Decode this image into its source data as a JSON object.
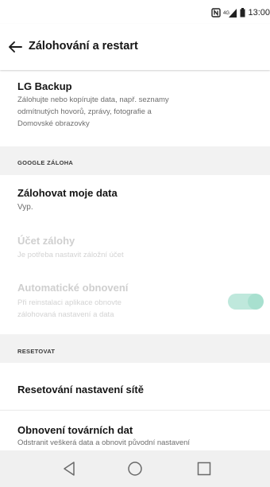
{
  "status_bar": {
    "time": "13:00",
    "icons": [
      "nfc-icon",
      "signal-icon",
      "battery-icon"
    ]
  },
  "app_bar": {
    "title": "Zálohování a restart",
    "back_icon": "arrow-left-icon"
  },
  "lg_backup": {
    "title": "LG Backup",
    "subtitle_lines": [
      "Zálohujte nebo kopírujte data, např. seznamy",
      "odmítnutých hovorů, zprávy, fotografie a",
      "Domovské obrazovky"
    ]
  },
  "google_section": {
    "label": "GOOGLE ZÁLOHA"
  },
  "backup_my_data": {
    "title": "Zálohovat moje data",
    "value": "Vyp."
  },
  "backup_account": {
    "title": "Účet zálohy",
    "subtitle": "Je potřeba nastavit záložní účet"
  },
  "auto_restore": {
    "title": "Automatické obnovení",
    "subtitle_lines": [
      "Při reinstalaci aplikace obnovte",
      "zálohovaná nastavení a data"
    ],
    "enabled": true
  },
  "reset_section": {
    "label": "RESETOVAT"
  },
  "network_reset": {
    "title": "Resetování nastavení sítě"
  },
  "factory_reset": {
    "title": "Obnovení továrních dat",
    "subtitle": "Odstranit veškerá data a obnovit původní nastavení"
  },
  "nav_bar": {
    "icons": [
      "back-triangle-icon",
      "home-circle-icon",
      "recents-square-icon"
    ]
  },
  "colors": {
    "toggle_track": "#bfe8dc",
    "toggle_thumb": "#a8e0cf",
    "section_bg": "#f2f2f2",
    "nav_bg": "#f0f0f0"
  }
}
